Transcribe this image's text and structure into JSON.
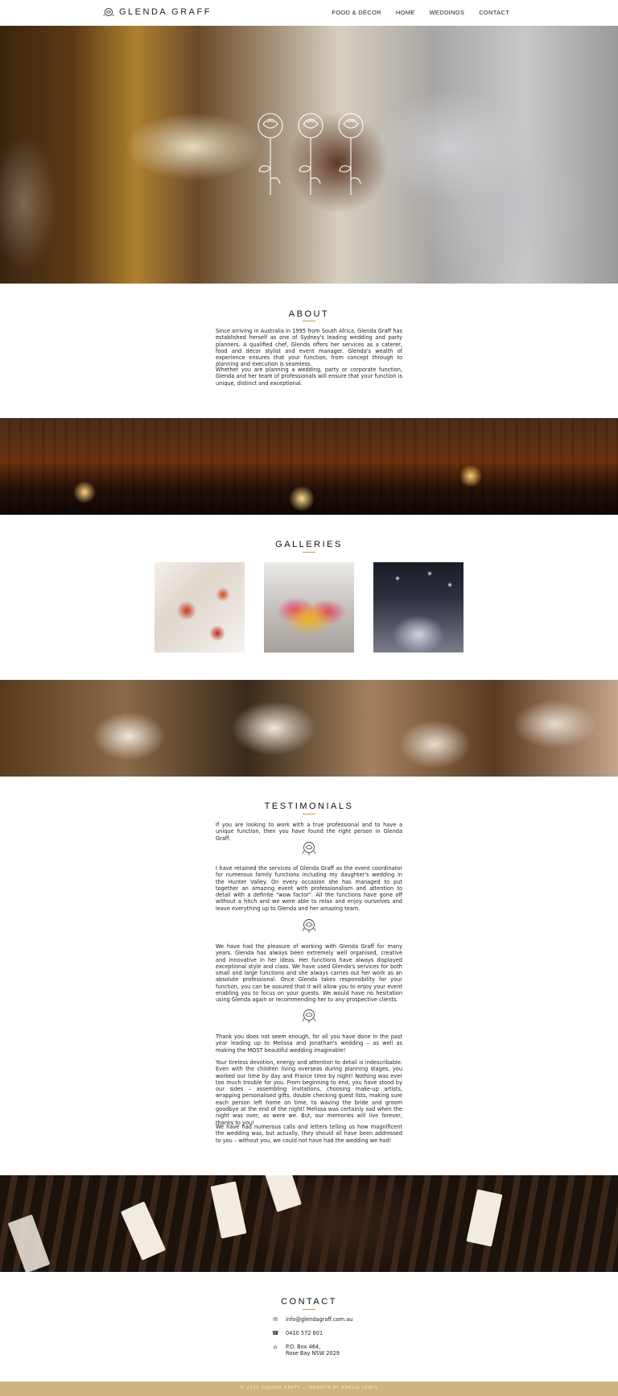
{
  "brand": {
    "name": "GLENDA GRAFF",
    "logo_icon": "rose-icon"
  },
  "nav": {
    "items": [
      "FOOD & DÉCOR",
      "HOME",
      "WEDDINGS",
      "CONTACT"
    ]
  },
  "about": {
    "title": "ABOUT",
    "paragraphs": [
      "Since arriving in Australia in 1995 from South Africa, Glenda Graff has established herself as one of Sydney's leading wedding and party planners. A qualified chef, Glenda offers her services as a caterer, food and décor stylist and event manager. Glenda's wealth of experience ensures that your function, from concept through to planning and execution is seamless.",
      "Whether you are planning a wedding, party or corporate function, Glenda and her team of professionals will ensure that your function is unique, distinct and exceptional."
    ]
  },
  "galleries": {
    "title": "GALLERIES"
  },
  "testimonials": {
    "title": "TESTIMONIALS",
    "items": [
      "If you are looking to work with a true professional and to have a unique function, then you have found the right person in Glenda Graff.",
      "I have retained the services of Glenda Graff as the event coordinator for numerous family functions including my daughter's wedding in the Hunter Valley. On every occasion she has managed to put together an amazing event with professionalism and attention to detail with a definite \"wow factor\". All the functions have gone off without a hitch and we were able to relax and enjoy ourselves and leave everything up to Glenda and her amazing team.",
      "We have had the pleasure of working with Glenda Graff for many years. Glenda has always been extremely well organised, creative and innovative in her ideas. Her functions have always displayed exceptional style and class. We have used Glenda's services for both small and large functions and she always carries out her work as an absolute professional. Once Glenda takes responsibility for your function, you can be assured that it will allow you to enjoy your event enabling you to focus on your guests. We would have no hesitation using Glenda again or recommending her to any prospective clients."
    ],
    "last_paragraphs": [
      "Thank you does not seem enough, for all you have done in the past year leading up to Melissa and Jonathan's wedding – as well as making the MOST beautiful wedding imaginable!",
      "Your tireless devotion, energy and attention to detail is indescribable. Even with the children living overseas during planning stages, you worked our time by day and France time by night! Nothing was ever too much trouble for you. From beginning to end, you have stood by our sides – assembling invitations, choosing make-up artists, wrapping personalised gifts, double checking guest lists, making sure each person left home on time, to waving the bride and groom goodbye at the end of the night! Melissa was certainly sad when the night was over, as were we. But, our memories will live forever, thanks to you!",
      "We have had numerous calls and letters telling us how magnificent the wedding was, but actually, they should all have been addressed to you – without you, we could not have had the wedding we had!"
    ]
  },
  "contact": {
    "title": "CONTACT",
    "email": "info@glendagraff.com.au",
    "phone": "0410 572 601",
    "address_line1": "P.O. Box 464,",
    "address_line2": "Rose Bay NSW 2029",
    "icons": [
      "envelope-icon",
      "phone-icon",
      "home-icon"
    ]
  },
  "footer": {
    "text": "© 2015 GLENDA GRAFF — WEBSITE BY AMELIA LEWIS"
  },
  "colors": {
    "accent": "#c59b45",
    "footer": "#cdb47e"
  }
}
